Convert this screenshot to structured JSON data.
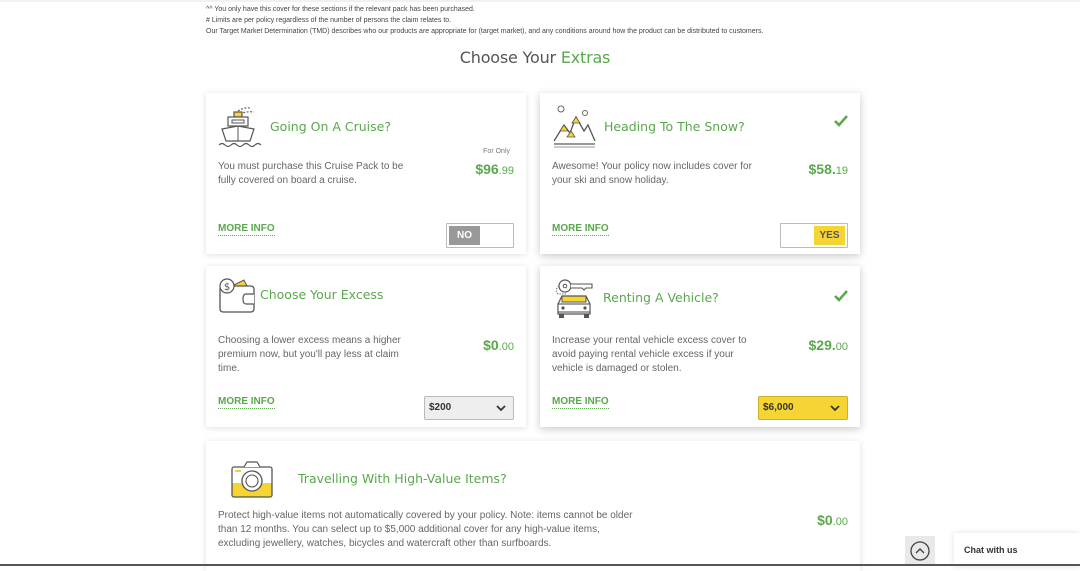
{
  "footnotes": [
    "^^ You only have this cover for these sections if the relevant pack has been purchased.",
    "# Limits are per policy regardless of the number of persons the claim relates to.",
    "Our Target Market Determination (TMD) describes who our products are appropriate for (target market), and any conditions around how the product can be distributed to customers."
  ],
  "section_title": {
    "plain": "Choose Your",
    "accent": "Extras"
  },
  "colors": {
    "accent_green": "#5aa84c",
    "accent_yellow": "#f5d433",
    "toggle_off_grey": "#999999"
  },
  "cards": {
    "cruise": {
      "icon": "cruise-ship-icon",
      "title": "Going On A Cruise?",
      "description": "You must purchase this Cruise Pack to be fully covered on board a cruise.",
      "for_only": "For Only",
      "price_dollars": "$96",
      "price_cents": ".99",
      "more_info": "MORE INFO",
      "toggle_label": "NO",
      "selected": false
    },
    "snow": {
      "icon": "snow-mountain-icon",
      "title": "Heading To The Snow?",
      "description": "Awesome! Your policy now includes cover for your ski and snow holiday.",
      "price_dollars": "$58.",
      "price_cents": "19",
      "more_info": "MORE INFO",
      "toggle_label": "YES",
      "selected": true
    },
    "excess": {
      "icon": "wallet-icon",
      "title": "Choose Your Excess",
      "description": "Choosing a lower excess means a higher premium now, but you'll pay less at claim time.",
      "price_dollars": "$0",
      "price_cents": ".00",
      "more_info": "MORE INFO",
      "select_value": "$200"
    },
    "vehicle": {
      "icon": "rental-car-key-icon",
      "title": "Renting A Vehicle?",
      "description": "Increase your rental vehicle excess cover to avoid paying rental vehicle excess if your vehicle is damaged or stolen.",
      "price_dollars": "$29.",
      "price_cents": "00",
      "more_info": "MORE INFO",
      "select_value": "$6,000",
      "selected": true
    },
    "high_value": {
      "icon": "camera-icon",
      "title": "Travelling With High-Value Items?",
      "description": "Protect high-value items not automatically covered by your policy. Note: items cannot be older than 12 months. You can select up to $5,000 additional cover for any high-value items, excluding jewellery, watches, bicycles and watercraft other than surfboards.",
      "price_dollars": "$0",
      "price_cents": ".00"
    }
  },
  "chat": {
    "label": "Chat with us"
  }
}
